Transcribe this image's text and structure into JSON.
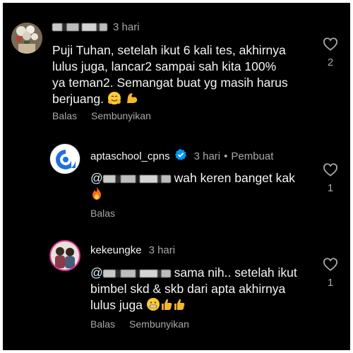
{
  "comments": [
    {
      "time": "3 hari",
      "lines": [
        "Puji Tuhan, setelah ikut 6 kali tes, akhirnya",
        "lulus juga, lancar2 sampai sah kita 100%",
        "ya teman2. Semangat buat yg masih harus",
        "berjuang."
      ],
      "emojis": [
        "hugging-face-emoji",
        "flexed-biceps-emoji"
      ],
      "actions": {
        "reply": "Balas",
        "hide": "Sembunyikan"
      },
      "likes": "2"
    },
    {
      "username": "aptaschool_cpns",
      "time": "3 hari",
      "separator": "•",
      "tag": "Pembuat",
      "mention": "@",
      "line1": "wah keren banget kak",
      "emojis": [
        "fire-emoji"
      ],
      "actions": {
        "reply": "Balas"
      },
      "likes": "1"
    },
    {
      "username": "kekeungke",
      "time": "3 hari",
      "mention": "@",
      "line1": "sama nih.. setelah ikut",
      "line2": "bimbel skd & skb dari apta akhirnya",
      "line3": "lulus juga",
      "emojis": [
        "grimacing-face-emoji",
        "thumbs-up-emoji",
        "thumbs-up-emoji"
      ],
      "actions": {
        "reply": "Balas",
        "hide": "Sembunyikan"
      },
      "likes": "1"
    }
  ],
  "colors": {
    "background": "#000000",
    "text": "#f5f5f5",
    "secondary": "#a8a8a8",
    "verified": "#0095f6",
    "apta_logo": "#1f6fe0"
  },
  "icons": [
    "heart-outline-icon",
    "verified-badge-icon"
  ]
}
